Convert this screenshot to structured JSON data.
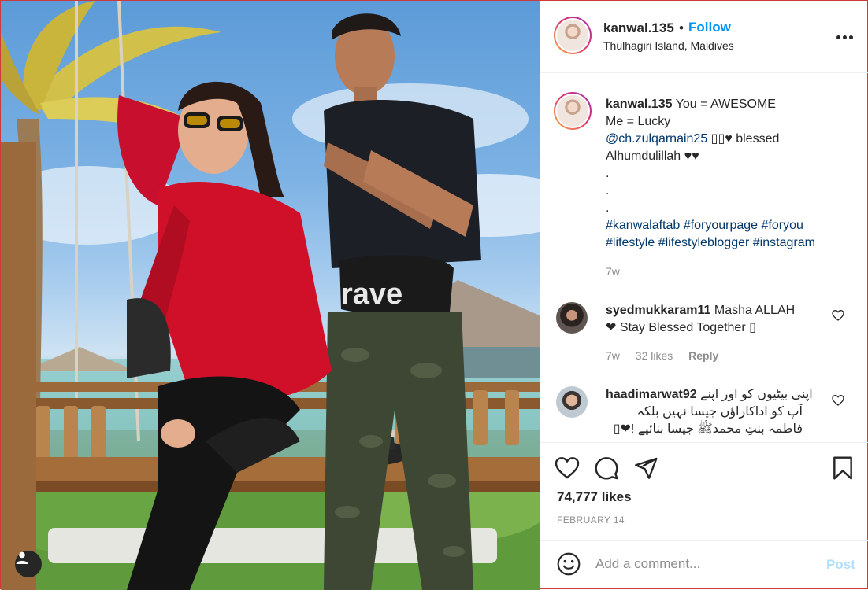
{
  "post": {
    "username": "kanwal.135",
    "separator": "•",
    "follow_label": "Follow",
    "location": "Thulhagiri Island, Maldives",
    "more_icon": "more-options-icon"
  },
  "caption": {
    "username": "kanwal.135",
    "line1": "You = AWESOME",
    "line2": "Me = Lucky",
    "mention": "@ch.zulqarnain25",
    "line3_rest": " ▯▯♥ blessed",
    "line4": "Alhumdulillah ♥♥",
    "dot1": ".",
    "dot2": ".",
    "dot3": ".",
    "hashtags": [
      "#kanwalaftab",
      "#foryourpage",
      "#foryou",
      "#lifestyle",
      "#lifestyleblogger",
      "#instagram"
    ],
    "time": "7w"
  },
  "comments": [
    {
      "username": "syedmukkaram11",
      "text_line1": "Masha ALLAH",
      "text_line2": "❤ Stay Blessed Together ▯",
      "time": "7w",
      "likes": "32 likes",
      "reply": "Reply"
    },
    {
      "username": "haadimarwat92",
      "text_line1": "اپنی بیٹیوں کو اور اپنے",
      "text_line2": "آپ کو اداکاراؤں جیسا نہیں بلکہ",
      "text_line3": "فاطمہ بنتِ محمدﷺ جیسا بنائیے !❤▯"
    }
  ],
  "actions": {
    "likes": "74,777 likes",
    "date": "FEBRUARY 14"
  },
  "add_comment": {
    "placeholder": "Add a comment...",
    "post_label": "Post"
  },
  "photo": {
    "bag_text": "rave"
  },
  "colors": {
    "accent": "#0095f6",
    "post_disabled": "#b2dffc",
    "link": "#00376b",
    "muted": "#8e8e8e"
  }
}
